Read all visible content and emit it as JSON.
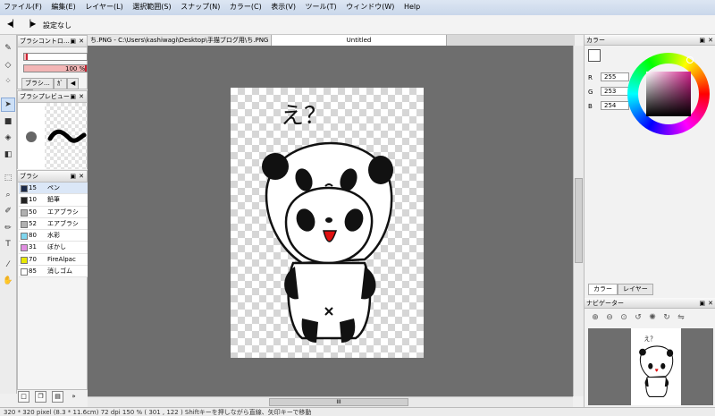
{
  "menu": [
    "ファイル(F)",
    "編集(E)",
    "レイヤー(L)",
    "選択範囲(S)",
    "スナップ(N)",
    "カラー(C)",
    "表示(V)",
    "ツール(T)",
    "ウィンドウ(W)",
    "Help"
  ],
  "toolbar": {
    "snap_label": "設定なし"
  },
  "brush_control": {
    "title": "ブラシコントロ…",
    "size_value": "15",
    "opacity_value": "100 %",
    "size_fraction": 0.06,
    "opacity_fraction": 1.0,
    "tabs": [
      "ブラシ…",
      "ｶﾞ"
    ]
  },
  "brush_preview": {
    "title": "ブラシプレビュー"
  },
  "brushes": {
    "title": "ブラシ",
    "items": [
      {
        "size": "15",
        "name": "ペン",
        "color": "#1a2a4a",
        "selected": true
      },
      {
        "size": "10",
        "name": "鉛筆",
        "color": "#222222"
      },
      {
        "size": "50",
        "name": "エアブラシ",
        "color": "#b0b0b0"
      },
      {
        "size": "52",
        "name": "エアブラシ",
        "color": "#b0b0b0"
      },
      {
        "size": "80",
        "name": "水彩",
        "color": "#7fd6ee"
      },
      {
        "size": "31",
        "name": "ぼかし",
        "color": "#e08ee0"
      },
      {
        "size": "70",
        "name": "FireAlpac",
        "color": "#e8e800"
      },
      {
        "size": "85",
        "name": "消しゴム",
        "color": "#ffffff"
      }
    ]
  },
  "document_tabs": [
    "ち.PNG - C:\\Users\\kashiwagi\\Desktop\\手描ブログ用\\ち.PNG",
    "Untitled"
  ],
  "canvas_text": "え？",
  "color_panel": {
    "title": "カラー",
    "r_label": "R",
    "r_value": "255",
    "g_label": "G",
    "g_value": "253",
    "b_label": "B",
    "b_value": "254",
    "tabs": [
      "カラー",
      "レイヤー"
    ]
  },
  "navigator": {
    "title": "ナビゲーター"
  },
  "hscroll_label": "III",
  "status": "320 * 320 pixel   (8.3 * 11.6cm)   72 dpi   150 %   ( 301 , 122 )   Shiftキーを押しながら直線、矢印キーで移動"
}
